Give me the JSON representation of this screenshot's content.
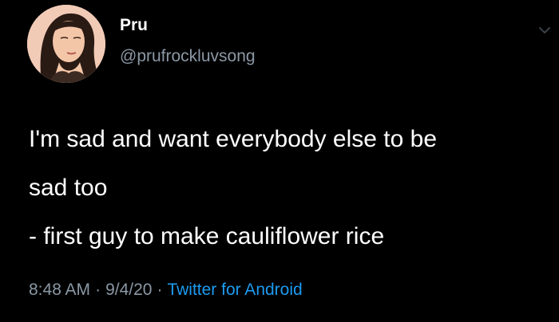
{
  "author": {
    "display_name": "Pru",
    "handle": "@prufrockluvsong"
  },
  "tweet": {
    "lines": [
      "I'm sad and want everybody else to be",
      "sad too",
      "- first guy to make cauliflower rice"
    ]
  },
  "meta": {
    "time": "8:48 AM",
    "date": "9/4/20",
    "separator": "·",
    "source": "Twitter for Android"
  },
  "icons": {
    "menu": "chevron-down-icon"
  },
  "colors": {
    "background": "#000000",
    "text": "#ffffff",
    "secondary": "#8b98a5",
    "link": "#1d9bf0"
  }
}
